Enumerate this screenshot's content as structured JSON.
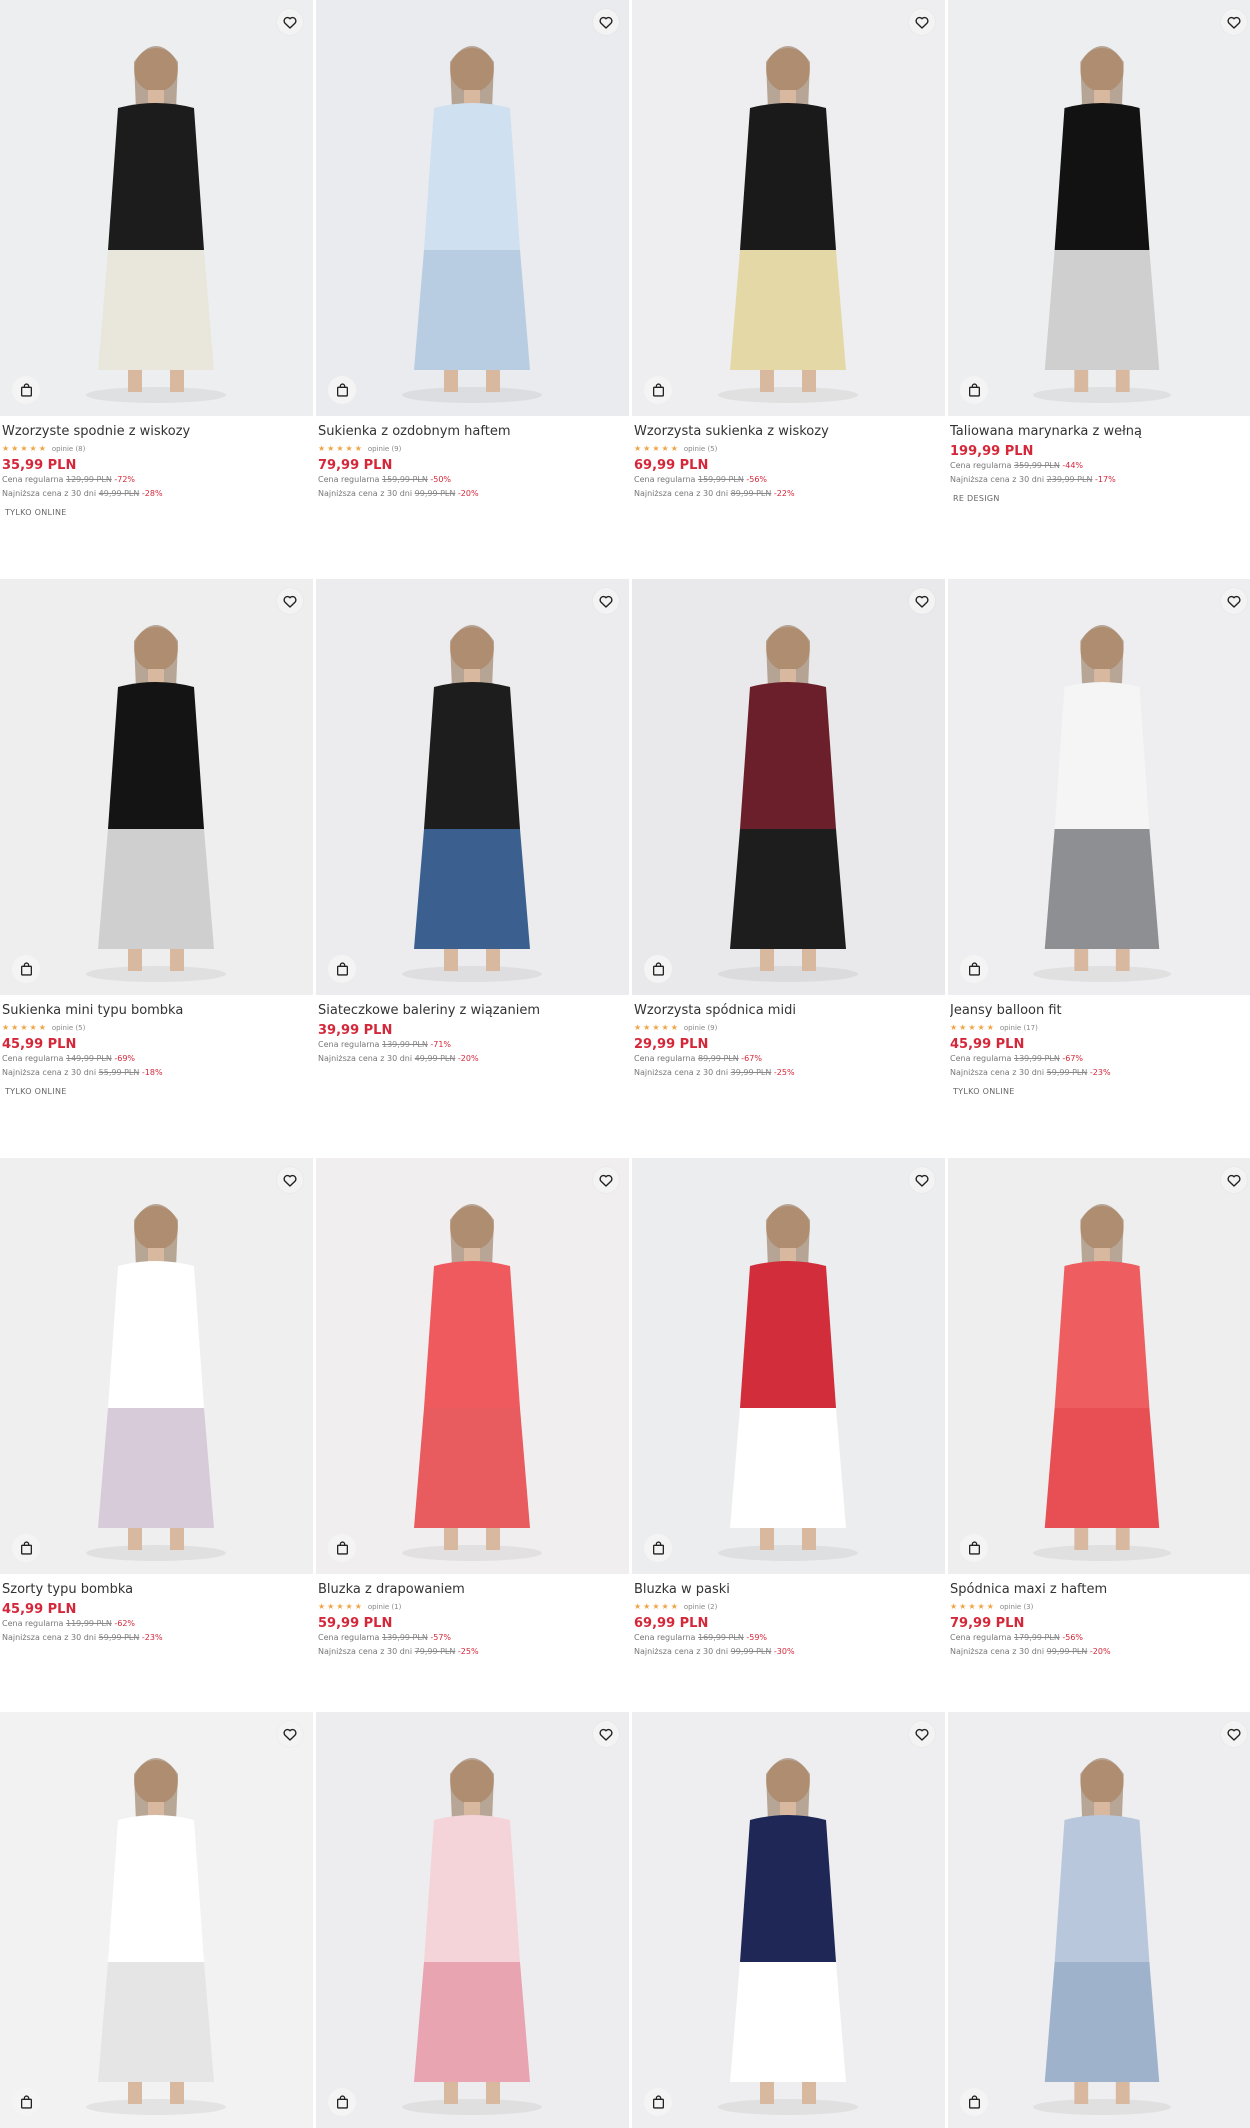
{
  "colors": {
    "price": "#d4283a",
    "stars": "#f0a445",
    "image_bg": "#eeeef0"
  },
  "products": [
    {
      "name": "Wzorzyste spodnie z wiskozy",
      "stars": "★★★★★",
      "reviews": "opinie (8)",
      "price": "35,99 PLN",
      "regular_label": "Cena regularna",
      "regular_price": "129,99 PLN",
      "regular_discount": "-72%",
      "lowest_label": "Najniższa cena z 30 dni",
      "lowest_price": "49,99 PLN",
      "lowest_discount": "-28%",
      "tag": "TYLKO ONLINE",
      "icons": {
        "fav": "heart-icon",
        "bag": "shopping-bag-icon"
      }
    },
    {
      "name": "Sukienka z ozdobnym haftem",
      "stars": "★★★★★",
      "reviews": "opinie (9)",
      "price": "79,99 PLN",
      "regular_label": "Cena regularna",
      "regular_price": "159,99 PLN",
      "regular_discount": "-50%",
      "lowest_label": "Najniższa cena z 30 dni",
      "lowest_price": "99,99 PLN",
      "lowest_discount": "-20%",
      "tag": ""
    },
    {
      "name": "Wzorzysta sukienka z wiskozy",
      "stars": "★★★★★",
      "reviews": "opinie (5)",
      "price": "69,99 PLN",
      "regular_label": "Cena regularna",
      "regular_price": "159,99 PLN",
      "regular_discount": "-56%",
      "lowest_label": "Najniższa cena z 30 dni",
      "lowest_price": "89,99 PLN",
      "lowest_discount": "-22%",
      "tag": ""
    },
    {
      "name": "Taliowana marynarka z wełną",
      "stars": "",
      "reviews": "",
      "price": "199,99 PLN",
      "regular_label": "Cena regularna",
      "regular_price": "359,99 PLN",
      "regular_discount": "-44%",
      "lowest_label": "Najniższa cena z 30 dni",
      "lowest_price": "239,99 PLN",
      "lowest_discount": "-17%",
      "tag": "RE DESIGN"
    },
    {
      "name": "Sukienka mini typu bombka",
      "stars": "★★★★★",
      "reviews": "opinie (5)",
      "price": "45,99 PLN",
      "regular_label": "Cena regularna",
      "regular_price": "149,99 PLN",
      "regular_discount": "-69%",
      "lowest_label": "Najniższa cena z 30 dni",
      "lowest_price": "55,99 PLN",
      "lowest_discount": "-18%",
      "tag": "TYLKO ONLINE"
    },
    {
      "name": "Siateczkowe baleriny z wiązaniem",
      "stars": "",
      "reviews": "",
      "price": "39,99 PLN",
      "regular_label": "Cena regularna",
      "regular_price": "139,99 PLN",
      "regular_discount": "-71%",
      "lowest_label": "Najniższa cena z 30 dni",
      "lowest_price": "49,99 PLN",
      "lowest_discount": "-20%",
      "tag": ""
    },
    {
      "name": "Wzorzysta spódnica midi",
      "stars": "★★★★★",
      "reviews": "opinie (9)",
      "price": "29,99 PLN",
      "regular_label": "Cena regularna",
      "regular_price": "89,99 PLN",
      "regular_discount": "-67%",
      "lowest_label": "Najniższa cena z 30 dni",
      "lowest_price": "39,99 PLN",
      "lowest_discount": "-25%",
      "tag": ""
    },
    {
      "name": "Jeansy balloon fit",
      "stars": "★★★★★",
      "reviews": "opinie (17)",
      "price": "45,99 PLN",
      "regular_label": "Cena regularna",
      "regular_price": "139,99 PLN",
      "regular_discount": "-67%",
      "lowest_label": "Najniższa cena z 30 dni",
      "lowest_price": "59,99 PLN",
      "lowest_discount": "-23%",
      "tag": "TYLKO ONLINE"
    },
    {
      "name": "Szorty typu bombka",
      "stars": "",
      "reviews": "",
      "price": "45,99 PLN",
      "regular_label": "Cena regularna",
      "regular_price": "119,99 PLN",
      "regular_discount": "-62%",
      "lowest_label": "Najniższa cena z 30 dni",
      "lowest_price": "59,99 PLN",
      "lowest_discount": "-23%",
      "tag": ""
    },
    {
      "name": "Bluzka z drapowaniem",
      "stars": "★★★★★",
      "reviews": "opinie (1)",
      "price": "59,99 PLN",
      "regular_label": "Cena regularna",
      "regular_price": "139,99 PLN",
      "regular_discount": "-57%",
      "lowest_label": "Najniższa cena z 30 dni",
      "lowest_price": "79,99 PLN",
      "lowest_discount": "-25%",
      "tag": ""
    },
    {
      "name": "Bluzka w paski",
      "stars": "★★★★★",
      "reviews": "opinie (2)",
      "price": "69,99 PLN",
      "regular_label": "Cena regularna",
      "regular_price": "169,99 PLN",
      "regular_discount": "-59%",
      "lowest_label": "Najniższa cena z 30 dni",
      "lowest_price": "99,99 PLN",
      "lowest_discount": "-30%",
      "tag": ""
    },
    {
      "name": "Spódnica maxi z haftem",
      "stars": "★★★★★",
      "reviews": "opinie (3)",
      "price": "79,99 PLN",
      "regular_label": "Cena regularna",
      "regular_price": "179,99 PLN",
      "regular_discount": "-56%",
      "lowest_label": "Najniższa cena z 30 dni",
      "lowest_price": "99,99 PLN",
      "lowest_discount": "-20%",
      "tag": ""
    },
    {
      "name": "",
      "stars": "",
      "reviews": "",
      "price": "",
      "regular_label": "",
      "regular_price": "",
      "regular_discount": "",
      "lowest_label": "",
      "lowest_price": "",
      "lowest_discount": "",
      "tag": ""
    },
    {
      "name": "",
      "stars": "",
      "reviews": "",
      "price": "",
      "regular_label": "",
      "regular_price": "",
      "regular_discount": "",
      "lowest_label": "",
      "lowest_price": "",
      "lowest_discount": "",
      "tag": ""
    },
    {
      "name": "",
      "stars": "",
      "reviews": "",
      "price": "",
      "regular_label": "",
      "regular_price": "",
      "regular_discount": "",
      "lowest_label": "",
      "lowest_price": "",
      "lowest_discount": "",
      "tag": ""
    },
    {
      "name": "",
      "stars": "",
      "reviews": "",
      "price": "",
      "regular_label": "",
      "regular_price": "",
      "regular_discount": "",
      "lowest_label": "",
      "lowest_price": "",
      "lowest_discount": "",
      "tag": ""
    }
  ]
}
